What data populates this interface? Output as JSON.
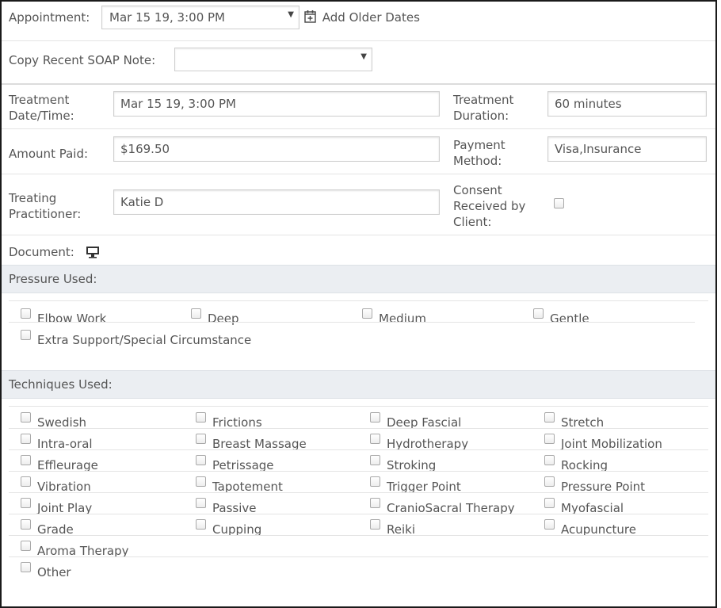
{
  "appointment": {
    "label": "Appointment:",
    "selected": "Mar 15 19, 3:00 PM",
    "add_older_label": "Add Older Dates",
    "icon": "calendar-add-icon"
  },
  "copy_soap": {
    "label": "Copy Recent SOAP Note:",
    "selected": ""
  },
  "treatment_datetime": {
    "label_line1": "Treatment",
    "label_line2": "Date/Time:",
    "value": "Mar 15 19, 3:00 PM"
  },
  "treatment_duration": {
    "label_line1": "Treatment",
    "label_line2": "Duration:",
    "value": "60 minutes"
  },
  "amount_paid": {
    "label": "Amount Paid:",
    "value": "$169.50"
  },
  "payment_method": {
    "label_line1": "Payment",
    "label_line2": "Method:",
    "value": "Visa,Insurance"
  },
  "practitioner": {
    "label_line1": "Treating",
    "label_line2": "Practitioner:",
    "value": "Katie D"
  },
  "consent": {
    "label_line1": "Consent",
    "label_line2": "Received by",
    "label_line3": "Client:",
    "checked": false
  },
  "document": {
    "label": "Document:",
    "icon": "monitor-icon"
  },
  "pressure": {
    "title": "Pressure Used:",
    "options": [
      "Elbow Work",
      "Deep",
      "Medium",
      "Gentle",
      "Extra Support/Special Circumstance"
    ]
  },
  "techniques": {
    "title": "Techniques Used:",
    "options": [
      "Swedish",
      "Frictions",
      "Deep Fascial",
      "Stretch",
      "Intra-oral",
      "Breast Massage",
      "Hydrotherapy",
      "Joint Mobilization",
      "Effleurage",
      "Petrissage",
      "Stroking",
      "Rocking",
      "Vibration",
      "Tapotement",
      "Trigger Point",
      "Pressure Point",
      "Joint Play",
      "Passive",
      "CranioSacral Therapy",
      "Myofascial",
      "Grade",
      "Cupping",
      "Reiki",
      "Acupuncture",
      "Aroma Therapy",
      "Other"
    ]
  }
}
